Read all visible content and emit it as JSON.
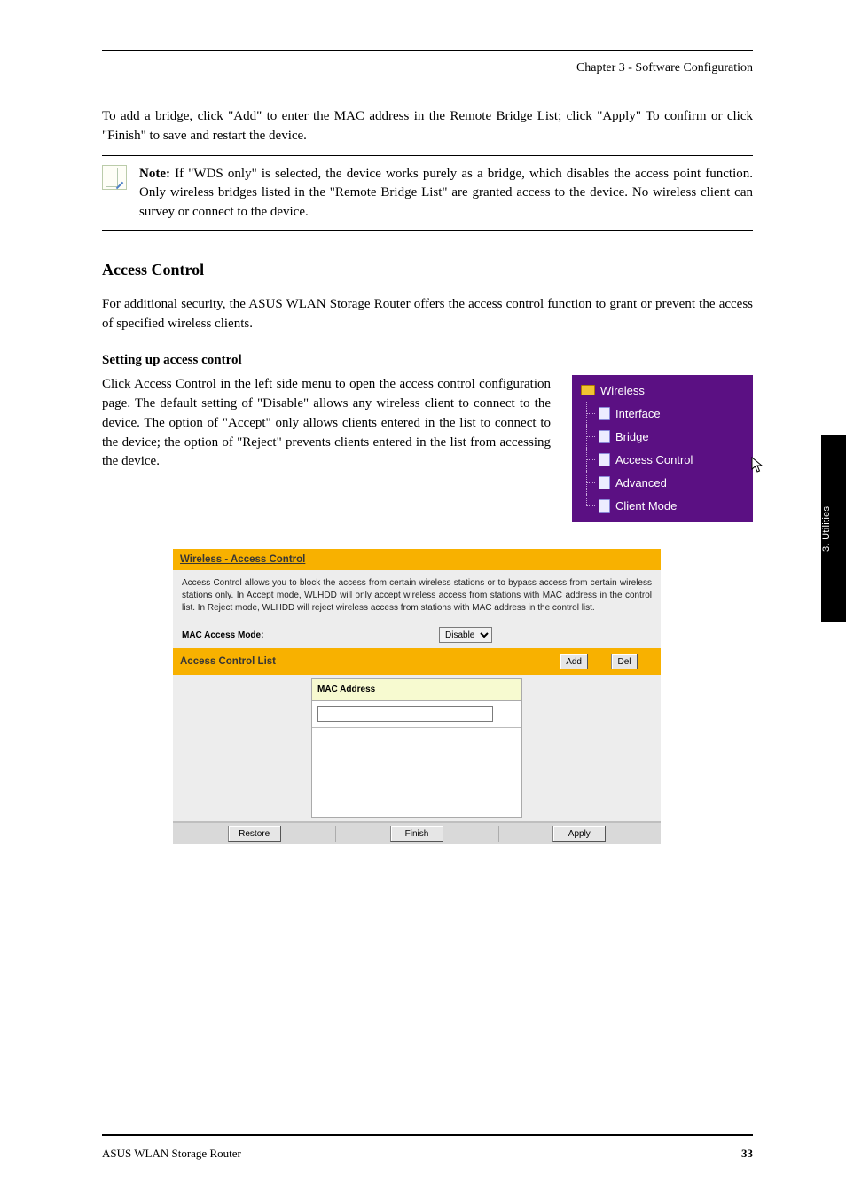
{
  "header": {
    "page_title_right": "Chapter 3 - Software Configuration"
  },
  "body": {
    "para1": "To add a bridge, click \"Add\" to enter the MAC address in the Remote Bridge List; click \"Apply\" To confirm or click \"Finish\" to save and restart the device.",
    "note_label": "Note:",
    "note_text": "If \"WDS only\" is selected, the device works purely as a bridge, which disables the access point function. Only wireless bridges listed in the \"Remote Bridge List\" are granted access to the device. No wireless client can survey or connect to the device.",
    "h2": "Access Control",
    "para2": "For additional security, the ASUS WLAN Storage Router offers the access control function to grant or prevent the access of specified wireless clients.",
    "h3": "Setting up access control",
    "para3": "Click Access Control in the left side menu to open the access control configuration page. The default setting of \"Disable\" allows any wireless client to connect to the device. The option of \"Accept\" only allows clients entered in the list to connect to the device; the option of \"Reject\" prevents clients entered in the list from accessing the device."
  },
  "menu": {
    "root": "Wireless",
    "items": [
      "Interface",
      "Bridge",
      "Access Control",
      "Advanced",
      "Client Mode"
    ]
  },
  "panel": {
    "title_main": "Wireless - Access Control",
    "desc": "Access Control allows you to block the access from certain wireless stations or to bypass access from certain wireless stations only. In Accept mode, WLHDD will only accept wireless access from stations with MAC address in the control list. In Reject mode, WLHDD will reject wireless access from stations with MAC address in the control list.",
    "mac_mode_label": "MAC Access Mode:",
    "mac_mode_value": "Disable",
    "title_list": "Access Control List",
    "btn_add": "Add",
    "btn_del": "Del",
    "mac_header": "MAC Address",
    "btn_restore": "Restore",
    "btn_finish": "Finish",
    "btn_apply": "Apply"
  },
  "side_tab": "3. Utilities",
  "footer": {
    "left": "ASUS WLAN Storage Router",
    "right": "33"
  }
}
